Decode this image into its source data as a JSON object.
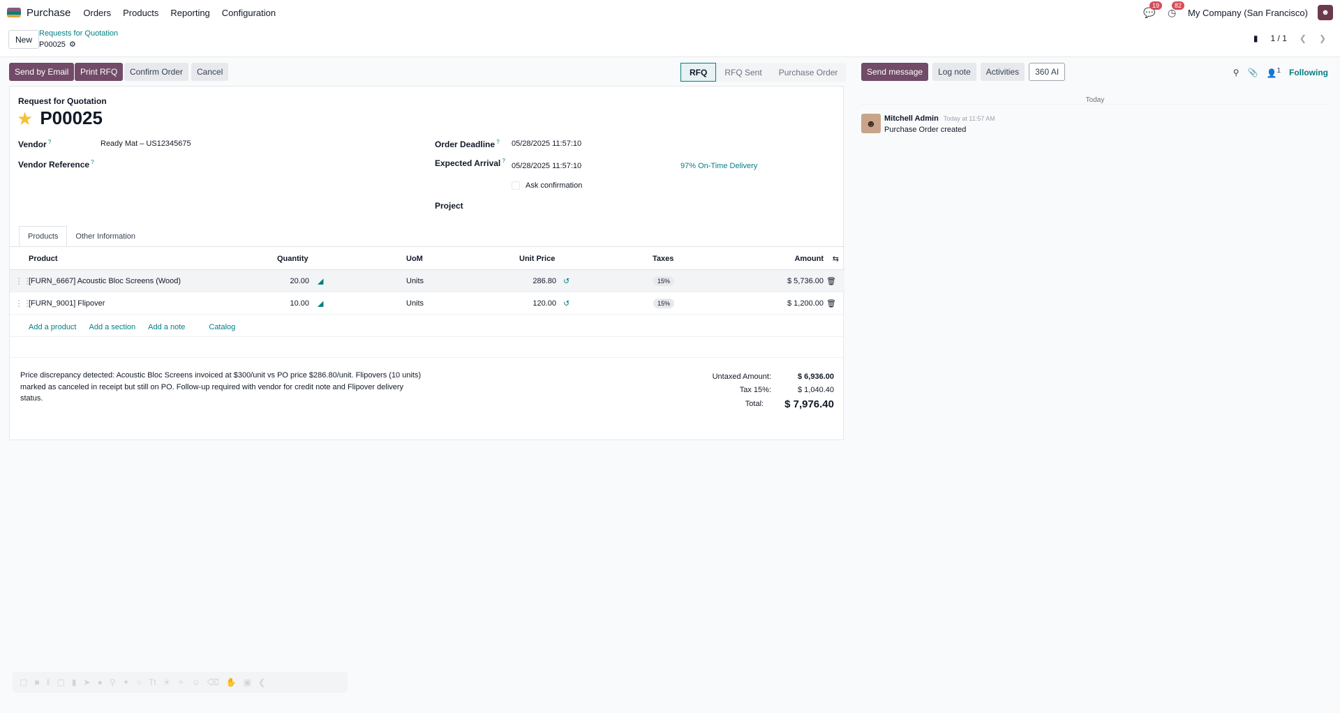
{
  "nav": {
    "app_name": "Purchase",
    "menus": [
      "Orders",
      "Products",
      "Reporting",
      "Configuration"
    ],
    "messages_count": "19",
    "activities_count": "82",
    "company": "My Company (San Francisco)"
  },
  "control": {
    "new_label": "New",
    "breadcrumb_parent": "Requests for Quotation",
    "breadcrumb_current": "P00025",
    "pager": "1 / 1"
  },
  "actions": {
    "send_email": "Send by Email",
    "print_rfq": "Print RFQ",
    "confirm": "Confirm Order",
    "cancel": "Cancel"
  },
  "status": {
    "stages": [
      "RFQ",
      "RFQ Sent",
      "Purchase Order"
    ],
    "active": "RFQ"
  },
  "chatter_actions": {
    "send_message": "Send message",
    "log_note": "Log note",
    "activities": "Activities",
    "ai": "360 AI",
    "followers": "1",
    "following": "Following"
  },
  "form": {
    "doc_type": "Request for Quotation",
    "number": "P00025",
    "vendor_label": "Vendor",
    "vendor_value": "Ready Mat – US12345675",
    "vendor_ref_label": "Vendor Reference",
    "order_deadline_label": "Order Deadline",
    "order_deadline_value": "05/28/2025 11:57:10",
    "expected_arrival_label": "Expected Arrival",
    "expected_arrival_value": "05/28/2025 11:57:10",
    "on_time": "97% On-Time Delivery",
    "ask_confirmation": "Ask confirmation",
    "project_label": "Project"
  },
  "tabs": [
    "Products",
    "Other Information"
  ],
  "table": {
    "headers": {
      "product": "Product",
      "quantity": "Quantity",
      "uom": "UoM",
      "unit_price": "Unit Price",
      "taxes": "Taxes",
      "amount": "Amount"
    },
    "rows": [
      {
        "product": "[FURN_6667] Acoustic Bloc Screens (Wood)",
        "quantity": "20.00",
        "uom": "Units",
        "unit_price": "286.80",
        "tax": "15%",
        "amount": "$ 5,736.00"
      },
      {
        "product": "[FURN_9001] Flipover",
        "quantity": "10.00",
        "uom": "Units",
        "unit_price": "120.00",
        "tax": "15%",
        "amount": "$ 1,200.00"
      }
    ],
    "add_product": "Add a product",
    "add_section": "Add a section",
    "add_note": "Add a note",
    "catalog": "Catalog"
  },
  "note": "Price discrepancy detected: Acoustic Bloc Screens invoiced at $300/unit vs PO price $286.80/unit. Flipovers (10 units) marked as canceled in receipt but still on PO. Follow-up required with vendor for credit note and Flipover delivery status.",
  "totals": {
    "untaxed_label": "Untaxed Amount:",
    "untaxed_value": "$ 6,936.00",
    "tax_label": "Tax 15%:",
    "tax_value": "$ 1,040.40",
    "total_label": "Total:",
    "total_value": "$ 7,976.40"
  },
  "chatter": {
    "date_separator": "Today",
    "author": "Mitchell Admin",
    "time": "Today at 11:57 AM",
    "body": "Purchase Order created"
  },
  "colors": {
    "primary": "#714b67",
    "accent": "#017e84",
    "star": "#f3c132",
    "badge": "#d44c59"
  }
}
